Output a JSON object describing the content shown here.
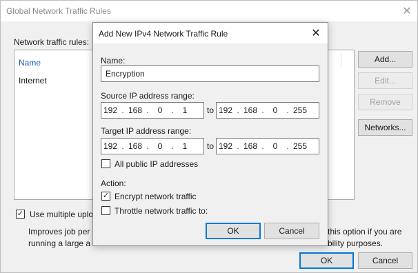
{
  "outer": {
    "title": "Global Network Traffic Rules",
    "rules_label": "Network traffic rules:",
    "list": {
      "column_header": "Name",
      "rows": [
        "Internet"
      ]
    },
    "buttons": {
      "add": "Add...",
      "edit": "Edit...",
      "remove": "Remove",
      "networks": "Networks...",
      "ok": "OK",
      "cancel": "Cancel"
    },
    "multi_upload": {
      "label": "Use multiple uplo",
      "checked": true
    },
    "description_left": [
      "Improves job per",
      "running a large a"
    ],
    "description_right": [
      "this option if you are",
      "bility purposes."
    ]
  },
  "dialog": {
    "title": "Add New IPv4 Network Traffic Rule",
    "name_label": "Name:",
    "name_value": "Encryption",
    "source_label": "Source IP address range:",
    "source_from": [
      "192",
      "168",
      "0",
      "1"
    ],
    "source_to": [
      "192",
      "168",
      "0",
      "255"
    ],
    "target_label": "Target IP address range:",
    "target_from": [
      "192",
      "168",
      "0",
      "1"
    ],
    "target_to": [
      "192",
      "168",
      "0",
      "255"
    ],
    "to_label": "to",
    "ip_separator": ".",
    "all_public_label": "All public IP addresses",
    "all_public_checked": false,
    "action_label": "Action:",
    "encrypt_label": "Encrypt network traffic",
    "encrypt_checked": true,
    "throttle_label": "Throttle network traffic to:",
    "throttle_checked": false,
    "ok": "OK",
    "cancel": "Cancel",
    "check_glyph": "✓"
  },
  "icons": {
    "close": "close-icon",
    "check": "check-icon"
  },
  "colors": {
    "accent": "#0078d7",
    "link_blue": "#1a5fb4",
    "window_bg": "#f0f0f0"
  }
}
